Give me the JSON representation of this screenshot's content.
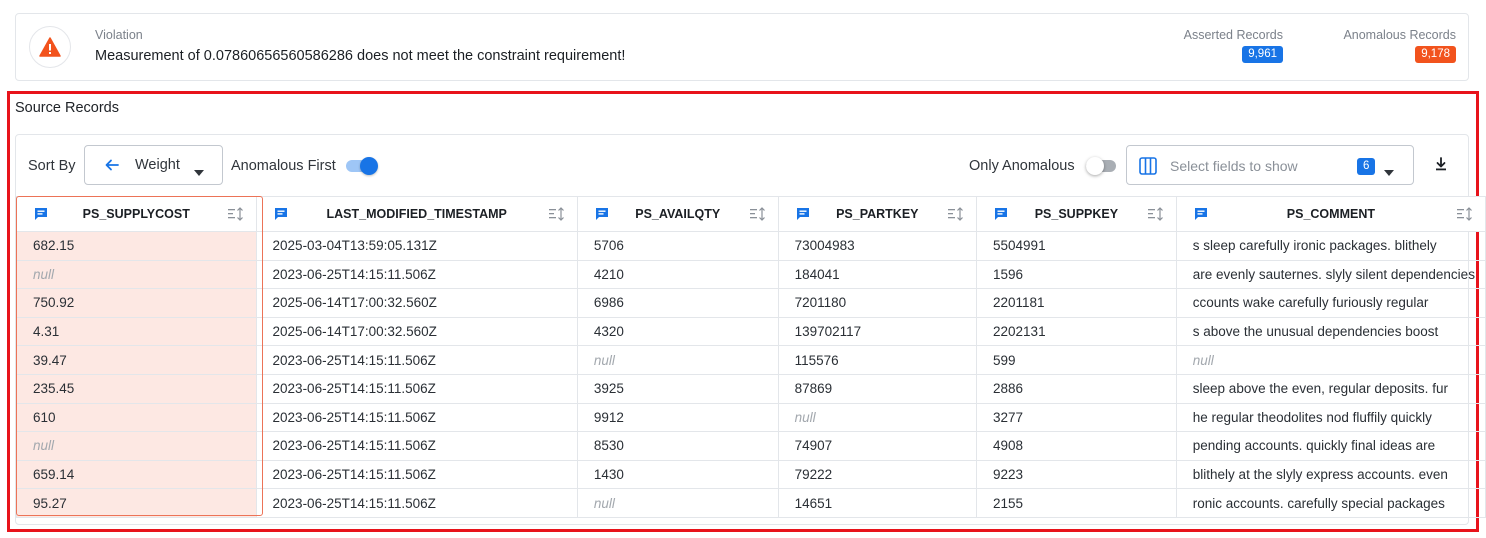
{
  "violation": {
    "icon": "warning-icon",
    "label": "Violation",
    "message": "Measurement of 0.07860656560586286 does not meet the constraint requirement!",
    "asserted_label": "Asserted Records",
    "asserted_count": "9,961",
    "anomalous_label": "Anomalous Records",
    "anomalous_count": "9,178"
  },
  "colors": {
    "asserted_badge": "#1874e6",
    "anomalous_badge": "#f2531d",
    "highlight_frame": "#e8131b",
    "anomalous_column_bg": "#fde8e3"
  },
  "section": {
    "title": "Source Records"
  },
  "toolbar": {
    "sort_label": "Sort By",
    "sort_value": "Weight",
    "anomalous_first_label": "Anomalous First",
    "anomalous_first_on": true,
    "only_anomalous_label": "Only Anomalous",
    "only_anomalous_on": false,
    "fields_placeholder": "Select fields to show",
    "fields_count": "6",
    "download_icon": "download-icon"
  },
  "table": {
    "columns": [
      "PS_SUPPLYCOST",
      "LAST_MODIFIED_TIMESTAMP",
      "PS_AVAILQTY",
      "PS_PARTKEY",
      "PS_SUPPKEY",
      "PS_COMMENT"
    ],
    "highlighted_column": 0,
    "rows": [
      [
        "682.15",
        "2025-03-04T13:59:05.131Z",
        "5706",
        "73004983",
        "5504991",
        "s sleep carefully ironic packages. blithely"
      ],
      [
        "null",
        "2023-06-25T14:15:11.506Z",
        "4210",
        "184041",
        "1596",
        "are evenly sauternes. slyly silent dependencies"
      ],
      [
        "750.92",
        "2025-06-14T17:00:32.560Z",
        "6986",
        "7201180",
        "2201181",
        "ccounts wake carefully furiously regular"
      ],
      [
        "4.31",
        "2025-06-14T17:00:32.560Z",
        "4320",
        "139702117",
        "2202131",
        "s above the unusual dependencies boost"
      ],
      [
        "39.47",
        "2023-06-25T14:15:11.506Z",
        "null",
        "115576",
        "599",
        "null"
      ],
      [
        "235.45",
        "2023-06-25T14:15:11.506Z",
        "3925",
        "87869",
        "2886",
        "sleep above the even, regular deposits. fur"
      ],
      [
        "610",
        "2023-06-25T14:15:11.506Z",
        "9912",
        "null",
        "3277",
        "he regular theodolites nod fluffily quickly"
      ],
      [
        "null",
        "2023-06-25T14:15:11.506Z",
        "8530",
        "74907",
        "4908",
        "pending accounts. quickly final ideas are"
      ],
      [
        "659.14",
        "2023-06-25T14:15:11.506Z",
        "1430",
        "79222",
        "9223",
        "blithely at the slyly express accounts. even"
      ],
      [
        "95.27",
        "2023-06-25T14:15:11.506Z",
        "null",
        "14651",
        "2155",
        "ronic accounts. carefully special packages"
      ]
    ]
  }
}
